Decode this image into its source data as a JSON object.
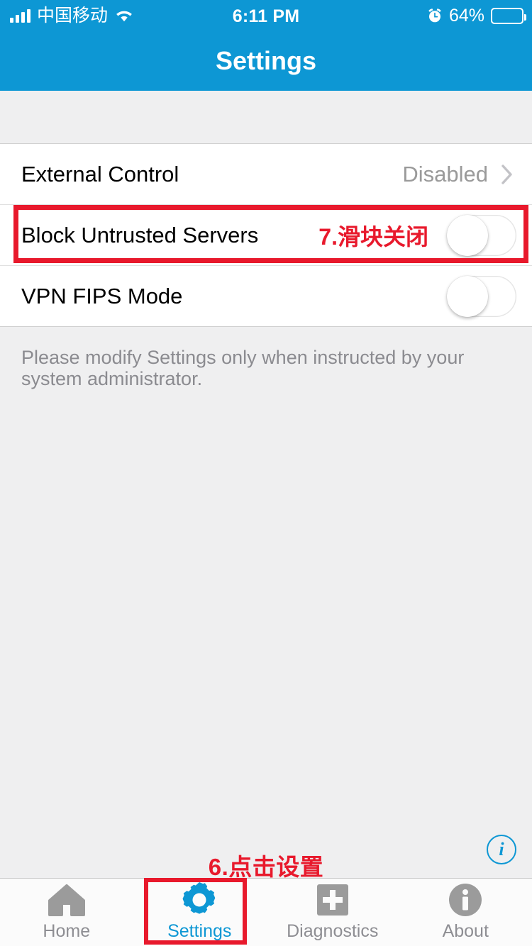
{
  "statusbar": {
    "carrier": "中国移动",
    "time": "6:11 PM",
    "battery_percent": "64%",
    "signal_icon": "cellular-signal-icon",
    "wifi_icon": "wifi-icon",
    "alarm_icon": "alarm-clock-icon",
    "battery_icon": "battery-icon",
    "battery_level": 64
  },
  "navbar": {
    "title": "Settings"
  },
  "settings": {
    "rows": [
      {
        "label": "External Control",
        "value": "Disabled",
        "type": "disclosure"
      },
      {
        "label": "Block Untrusted Servers",
        "value": "",
        "type": "toggle",
        "toggle_on": false,
        "annotation": "7.滑块关闭"
      },
      {
        "label": "VPN FIPS Mode",
        "value": "",
        "type": "toggle",
        "toggle_on": false,
        "annotation": ""
      }
    ],
    "footer_note": "Please modify Settings only when instructed by your system administrator."
  },
  "info_button": {
    "label": "i",
    "icon": "info-circle-icon"
  },
  "annotations": {
    "tab_hint": "6.点击设置",
    "row_hint": "7.滑块关闭",
    "color": "#e8192c"
  },
  "tabbar": {
    "items": [
      {
        "label": "Home",
        "icon": "home-icon",
        "active": false
      },
      {
        "label": "Settings",
        "icon": "gear-icon",
        "active": true
      },
      {
        "label": "Diagnostics",
        "icon": "plus-square-icon",
        "active": false
      },
      {
        "label": "About",
        "icon": "info-circle-filled-icon",
        "active": false
      }
    ]
  },
  "colors": {
    "accent": "#0d97d4",
    "annotation_red": "#e8192c",
    "background": "#efeff0",
    "inactive_gray": "#9a9a9a"
  }
}
